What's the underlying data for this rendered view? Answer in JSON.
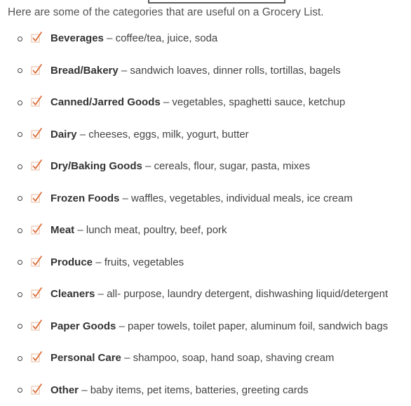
{
  "intro": "Here are some of the categories that are useful on a Grocery List.",
  "accent_color": "#d9632b",
  "separator": "–",
  "categories": [
    {
      "name": "Beverages",
      "items": "coffee/tea, juice, soda"
    },
    {
      "name": "Bread/Bakery",
      "items": "sandwich loaves, dinner rolls, tortillas, bagels"
    },
    {
      "name": "Canned/Jarred Goods",
      "items": "vegetables, spaghetti sauce, ketchup"
    },
    {
      "name": "Dairy",
      "items": "cheeses, eggs, milk, yogurt, butter"
    },
    {
      "name": "Dry/Baking Goods",
      "items": "cereals, flour, sugar, pasta, mixes"
    },
    {
      "name": "Frozen Foods",
      "items": "waffles, vegetables, individual meals, ice cream"
    },
    {
      "name": "Meat",
      "items": "lunch meat, poultry, beef, pork"
    },
    {
      "name": "Produce",
      "items": "fruits, vegetables"
    },
    {
      "name": "Cleaners",
      "items": "all- purpose, laundry detergent, dishwashing liquid/detergent"
    },
    {
      "name": "Paper Goods",
      "items": "paper towels, toilet paper, aluminum foil, sandwich bags"
    },
    {
      "name": "Personal Care",
      "items": "shampoo, soap, hand soap, shaving cream"
    },
    {
      "name": "Other",
      "items": "baby items, pet items, batteries, greeting cards"
    }
  ]
}
